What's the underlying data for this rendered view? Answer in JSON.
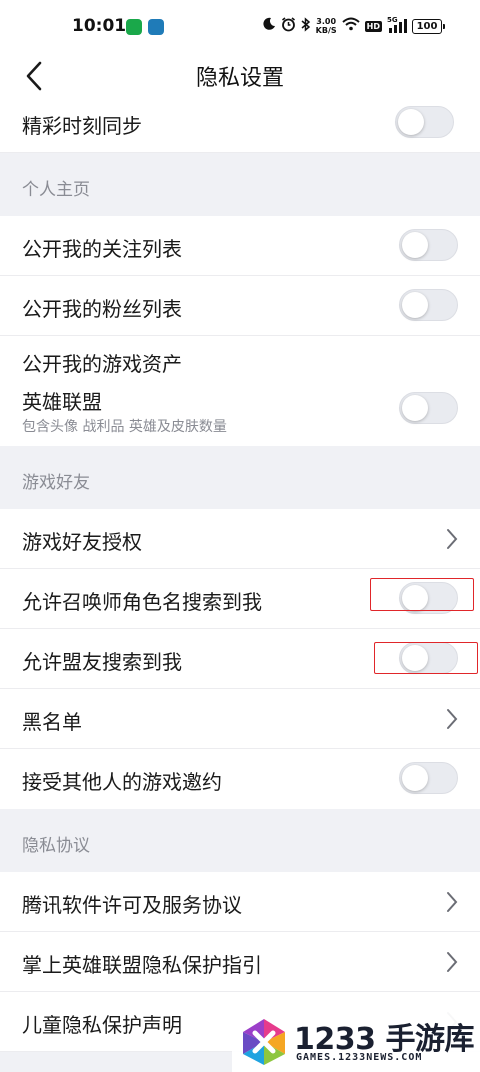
{
  "status_bar": {
    "time": "10:01",
    "net_speed_value": "3.00",
    "net_speed_unit": "KB/S",
    "hd": "HD",
    "signal": "5G",
    "battery": "100",
    "icons": [
      "moon-icon",
      "alarm-icon",
      "bluetooth-icon",
      "wifi-icon",
      "cellular-signal-icon",
      "battery-icon"
    ],
    "app_icon_colors": [
      "#1aa84a",
      "#1f7bb8"
    ]
  },
  "nav": {
    "title": "隐私设置",
    "back_icon": "chevron-left-icon"
  },
  "rows": {
    "highlights_sync": "精彩时刻同步",
    "section_profile": "个人主页",
    "public_following": "公开我的关注列表",
    "public_fans": "公开我的粉丝列表",
    "public_game_assets": "公开我的游戏资产",
    "lol": "英雄联盟",
    "lol_desc": "包含头像 战利品 英雄及皮肤数量",
    "section_friends": "游戏好友",
    "friend_auth": "游戏好友授权",
    "allow_summoner_search": "允许召唤师角色名搜索到我",
    "allow_ally_search": "允许盟友搜索到我",
    "blacklist": "黑名单",
    "accept_invites": "接受其他人的游戏邀约",
    "section_privacy": "隐私协议",
    "tencent_license": "腾讯软件许可及服务协议",
    "privacy_guide": "掌上英雄联盟隐私保护指引",
    "children_privacy": "儿童隐私保护声明"
  },
  "toggles": {
    "highlights_sync": false,
    "public_following": false,
    "public_fans": false,
    "lol_assets": false,
    "allow_summoner_search": false,
    "allow_ally_search": false,
    "accept_invites": false
  },
  "watermark": {
    "number": "1233",
    "text": "手游库",
    "site": "GAMES.1233NEWS.COM"
  },
  "colors": {
    "highlight_border": "#e0262a",
    "section_bg": "#f0f1f5",
    "toggle_off": "#e9ebf0"
  }
}
